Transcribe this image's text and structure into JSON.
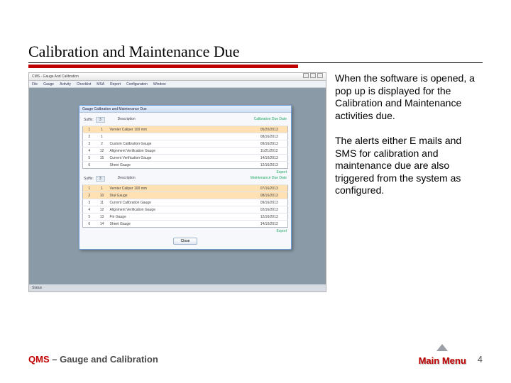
{
  "slide": {
    "heading": "Calibration and Maintenance Due",
    "para1": "When the software is opened, a pop up is displayed for the Calibration and Maintenance activities due.",
    "para2": "The alerts either E mails and SMS for calibration and maintenance due are also triggered from the system as configured."
  },
  "footer": {
    "brand": "QMS",
    "rest": " – Gauge and Calibration",
    "mainmenu": "Main Menu",
    "page": "4"
  },
  "app": {
    "window_title": "CMS - Gauge And Calibration",
    "menubar": [
      "File",
      "Gauge",
      "Activity",
      "Checklist",
      "MSA",
      "Report",
      "Configuration",
      "Window"
    ],
    "statusbar": "Status",
    "dialog_title": "Gauge Calibration and Maintenance Due",
    "filter_suffix_label": "Suffix",
    "filter_suffix_value": "3",
    "filter_desc_label": "Description",
    "col_headers": [
      "",
      "",
      "",
      "Calibration Due Date"
    ],
    "maint_col_header": "Maintenance Due Date",
    "export_label": "Export",
    "close_label": "Close",
    "calib_rows": [
      {
        "sl": "1",
        "gno": "1",
        "desc": "Vernier Caliper 100 mm",
        "date": "05/20/2013",
        "hl": true
      },
      {
        "sl": "2",
        "gno": "1",
        "desc": "",
        "date": "08/16/2013"
      },
      {
        "sl": "3",
        "gno": "2",
        "desc": "Custom Calibration Gauge",
        "date": "09/16/2013"
      },
      {
        "sl": "4",
        "gno": "12",
        "desc": "Alignment Verification Gauge",
        "date": "11/21/2012"
      },
      {
        "sl": "5",
        "gno": "15",
        "desc": "Current Verification Gauge",
        "date": "14/10/2013"
      },
      {
        "sl": "6",
        "gno": "",
        "desc": "Sheet Gauge",
        "date": "12/16/2013"
      }
    ],
    "maint_rows": [
      {
        "sl": "1",
        "gno": "1",
        "desc": "Vernier Caliper 100 mm",
        "date": "07/16/2013",
        "hl": true
      },
      {
        "sl": "2",
        "gno": "10",
        "desc": "Dial Gauge",
        "date": "08/16/2013",
        "hl": true
      },
      {
        "sl": "3",
        "gno": "11",
        "desc": "Current Calibration Gauge",
        "date": "09/16/2013"
      },
      {
        "sl": "4",
        "gno": "12",
        "desc": "Alignment Verification Gauge",
        "date": "02/16/2013"
      },
      {
        "sl": "5",
        "gno": "13",
        "desc": "Fin Gauge",
        "date": "12/16/2013"
      },
      {
        "sl": "6",
        "gno": "14",
        "desc": "Sheet Gauge",
        "date": "14/10/2012"
      }
    ]
  }
}
